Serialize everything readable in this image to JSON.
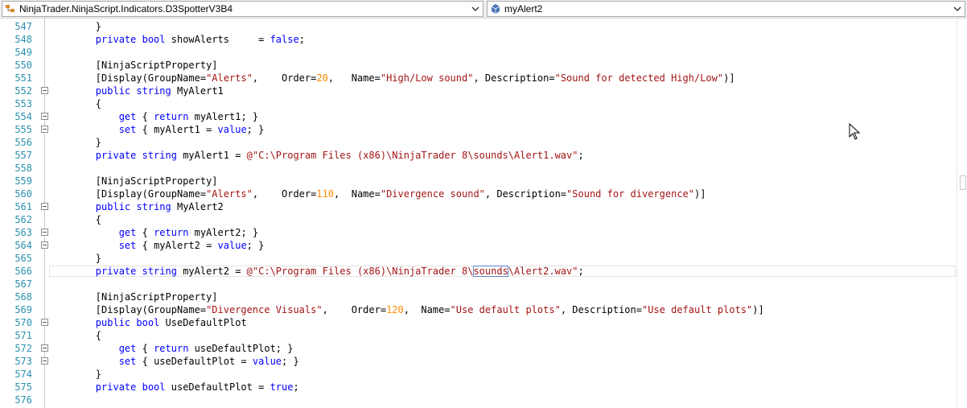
{
  "navigation": {
    "type_combo": {
      "value": "NinjaTrader.NinjaScript.Indicators.D3SpotterV3B4",
      "icon": "class-icon"
    },
    "member_combo": {
      "value": "myAlert2",
      "icon": "property-icon"
    }
  },
  "editor": {
    "selected_word": "sounds",
    "lines": [
      {
        "number": "547",
        "text": "        }"
      },
      {
        "number": "548",
        "text": "        private bool showAlerts     = false;"
      },
      {
        "number": "549",
        "text": ""
      },
      {
        "number": "550",
        "text": "        [NinjaScriptProperty]"
      },
      {
        "number": "551",
        "text": "        [Display(GroupName=\"Alerts\",    Order=20,   Name=\"High/Low sound\", Description=\"Sound for detected High/Low\")]"
      },
      {
        "number": "552",
        "text": "        public string MyAlert1"
      },
      {
        "number": "553",
        "text": "        {"
      },
      {
        "number": "554",
        "text": "            get { return myAlert1; }"
      },
      {
        "number": "555",
        "text": "            set { myAlert1 = value; }"
      },
      {
        "number": "556",
        "text": "        }"
      },
      {
        "number": "557",
        "text": "        private string myAlert1 = @\"C:\\Program Files (x86)\\NinjaTrader 8\\sounds\\Alert1.wav\";"
      },
      {
        "number": "558",
        "text": ""
      },
      {
        "number": "559",
        "text": "        [NinjaScriptProperty]"
      },
      {
        "number": "560",
        "text": "        [Display(GroupName=\"Alerts\",    Order=110,  Name=\"Divergence sound\", Description=\"Sound for divergence\")]"
      },
      {
        "number": "561",
        "text": "        public string MyAlert2"
      },
      {
        "number": "562",
        "text": "        {"
      },
      {
        "number": "563",
        "text": "            get { return myAlert2; }"
      },
      {
        "number": "564",
        "text": "            set { myAlert2 = value; }"
      },
      {
        "number": "565",
        "text": "        }"
      },
      {
        "number": "566",
        "text": "        private string myAlert2 = @\"C:\\Program Files (x86)\\NinjaTrader 8\\sounds\\Alert2.wav\";"
      },
      {
        "number": "567",
        "text": ""
      },
      {
        "number": "568",
        "text": "        [NinjaScriptProperty]"
      },
      {
        "number": "569",
        "text": "        [Display(GroupName=\"Divergence Visuals\",    Order=120,  Name=\"Use default plots\", Description=\"Use default plots\")]"
      },
      {
        "number": "570",
        "text": "        public bool UseDefaultPlot"
      },
      {
        "number": "571",
        "text": "        {"
      },
      {
        "number": "572",
        "text": "            get { return useDefaultPlot; }"
      },
      {
        "number": "573",
        "text": "            set { useDefaultPlot = value; }"
      },
      {
        "number": "574",
        "text": "        }"
      },
      {
        "number": "575",
        "text": "        private bool useDefaultPlot = true;"
      },
      {
        "number": "576",
        "text": ""
      }
    ]
  }
}
